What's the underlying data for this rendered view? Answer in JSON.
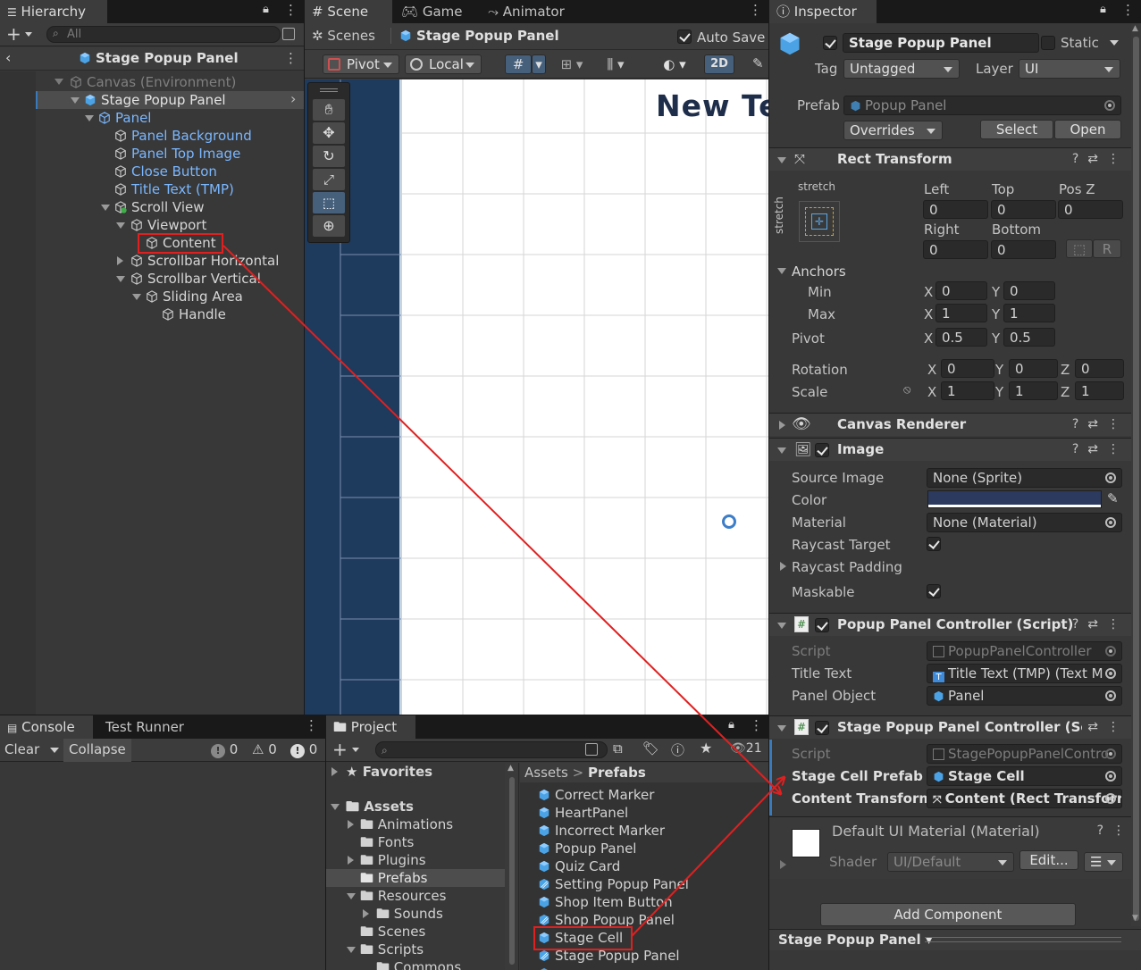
{
  "hierarchy": {
    "tab": "Hierarchy",
    "search_placeholder": "All",
    "breadcrumb": "Stage Popup Panel",
    "items": [
      {
        "label": "Canvas (Environment)"
      },
      {
        "label": "Stage Popup Panel"
      },
      {
        "label": "Panel"
      },
      {
        "label": "Panel Background"
      },
      {
        "label": "Panel Top Image"
      },
      {
        "label": "Close Button"
      },
      {
        "label": "Title Text (TMP)"
      },
      {
        "label": "Scroll View"
      },
      {
        "label": "Viewport"
      },
      {
        "label": "Content"
      },
      {
        "label": "Scrollbar Horizontal"
      },
      {
        "label": "Scrollbar Vertical"
      },
      {
        "label": "Sliding Area"
      },
      {
        "label": "Handle"
      }
    ]
  },
  "scene": {
    "tabs": [
      "Scene",
      "Game",
      "Animator"
    ],
    "scenes_label": "Scenes",
    "breadcrumb": "Stage Popup Panel",
    "auto_save": "Auto Save",
    "pivot": "Pivot",
    "local": "Local",
    "mode_2d": "2D",
    "canvas_text": "New Te"
  },
  "inspector": {
    "tab": "Inspector",
    "object_name": "Stage Popup Panel",
    "static_label": "Static",
    "tag_label": "Tag",
    "tag_value": "Untagged",
    "layer_label": "Layer",
    "layer_value": "UI",
    "prefab_label": "Prefab",
    "prefab_value": "Popup Panel",
    "overrides": "Overrides",
    "select_btn": "Select",
    "open_btn": "Open",
    "rect_transform": {
      "title": "Rect Transform",
      "stretch_top": "stretch",
      "stretch_side": "stretch",
      "left_label": "Left",
      "left": "0",
      "top_label": "Top",
      "top": "0",
      "posz_label": "Pos Z",
      "posz": "0",
      "right_label": "Right",
      "right": "0",
      "bottom_label": "Bottom",
      "bottom": "0",
      "r_btn": "R",
      "anchors_label": "Anchors",
      "min_label": "Min",
      "min_x": "0",
      "min_y": "0",
      "max_label": "Max",
      "max_x": "1",
      "max_y": "1",
      "pivot_label": "Pivot",
      "pivot_x": "0.5",
      "pivot_y": "0.5",
      "rotation_label": "Rotation",
      "rot_x": "0",
      "rot_y": "0",
      "rot_z": "0",
      "scale_label": "Scale",
      "scale_x": "1",
      "scale_y": "1",
      "scale_z": "1"
    },
    "canvas_renderer": "Canvas Renderer",
    "image": {
      "title": "Image",
      "source_image_label": "Source Image",
      "source_image": "None (Sprite)",
      "color_label": "Color",
      "color": "#2b3a5e",
      "material_label": "Material",
      "material": "None (Material)",
      "raycast_target_label": "Raycast Target",
      "raycast_padding_label": "Raycast Padding",
      "maskable_label": "Maskable"
    },
    "popup_controller": {
      "title": "Popup Panel Controller (Script)",
      "script_label": "Script",
      "script": "PopupPanelController",
      "title_text_label": "Title Text",
      "title_text": "Title Text (TMP) (Text M",
      "panel_object_label": "Panel Object",
      "panel_object": "Panel"
    },
    "stage_controller": {
      "title": "Stage Popup Panel Controller (Sc",
      "script_label": "Script",
      "script": "StagePopupPanelContro",
      "stage_cell_prefab_label": "Stage Cell Prefab",
      "stage_cell_prefab": "Stage Cell",
      "content_transform_label": "Content Transform",
      "content_transform": "Content (Rect Transforr"
    },
    "material": {
      "title": "Default UI Material (Material)",
      "shader_label": "Shader",
      "shader": "UI/Default",
      "edit_btn": "Edit..."
    },
    "add_component": "Add Component",
    "footer": "Stage Popup Panel"
  },
  "console": {
    "tabs": [
      "Console",
      "Test Runner"
    ],
    "clear": "Clear",
    "collapse": "Collapse",
    "info_count": "0",
    "warn_count": "0",
    "error_count": "0"
  },
  "project": {
    "tab": "Project",
    "hidden_count": "21",
    "favorites": "Favorites",
    "assets": "Assets",
    "tree": [
      "Animations",
      "Fonts",
      "Plugins",
      "Prefabs",
      "Resources",
      "Sounds",
      "Scenes",
      "Scripts",
      "Commons"
    ],
    "breadcrumb_root": "Assets",
    "breadcrumb_leaf": "Prefabs",
    "prefabs": [
      "Correct Marker",
      "HeartPanel",
      "Incorrect Marker",
      "Popup Panel",
      "Quiz Card",
      "Setting Popup Panel",
      "Shop Item Button",
      "Shop Popup Panel",
      "Stage Cell",
      "Stage Popup Panel"
    ]
  }
}
